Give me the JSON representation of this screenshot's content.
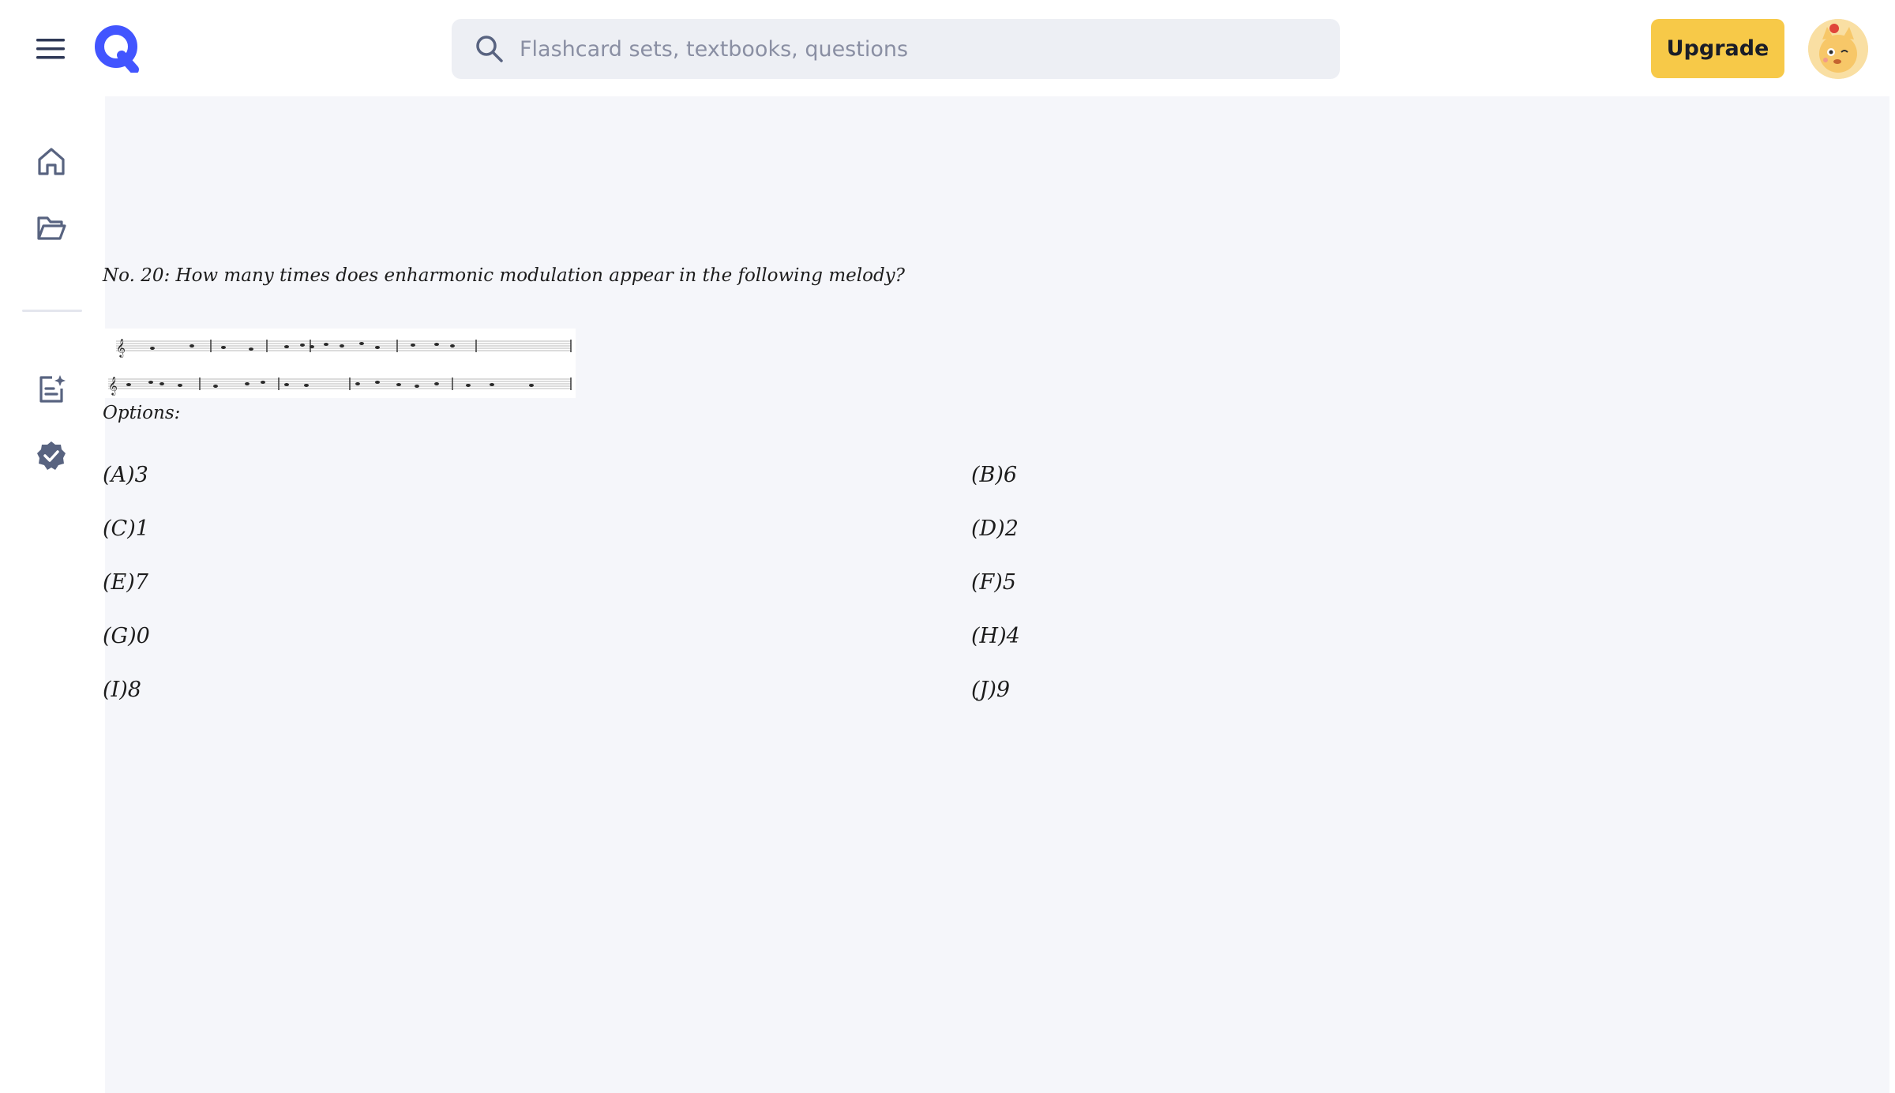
{
  "header": {
    "menu_icon": "hamburger-icon",
    "logo_icon": "quizlet-q-logo",
    "search": {
      "placeholder": "Flashcard sets, textbooks, questions",
      "value": ""
    },
    "upgrade_label": "Upgrade",
    "avatar_icon": "avatar-image"
  },
  "sidebar": {
    "items": [
      {
        "icon": "home-icon"
      },
      {
        "icon": "folder-icon"
      },
      {
        "icon": "sparkle-notes-icon"
      },
      {
        "icon": "verified-badge-icon"
      }
    ]
  },
  "question": {
    "text": "No. 20:  How many times does enharmonic modulation appear in the following melody?",
    "options_label": "Options:",
    "options": [
      "(A)3",
      "(B)6",
      "(C)1",
      "(D)2",
      "(E)7",
      "(F)5",
      "(G)0",
      "(H)4",
      "(I)8",
      "(J)9"
    ]
  },
  "colors": {
    "brand": "#4255ff",
    "upgrade": "#f7c948",
    "main_bg": "#f5f6fa",
    "icon": "#586380"
  }
}
